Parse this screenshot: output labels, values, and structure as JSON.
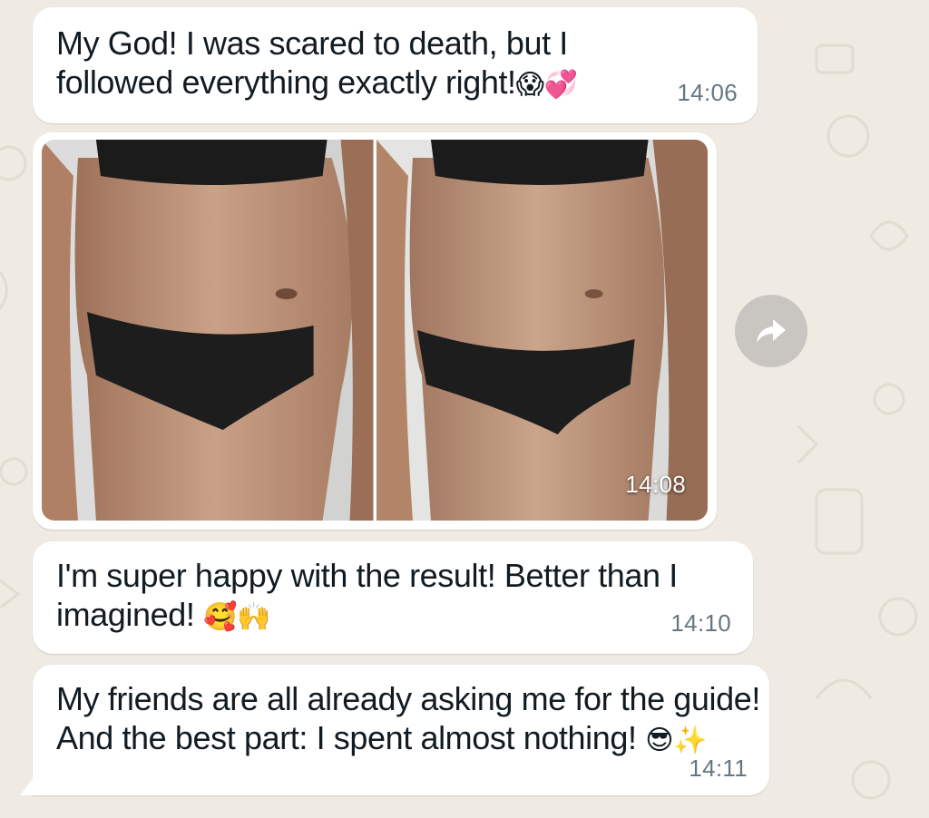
{
  "theme": {
    "chat_background": "#efeae2",
    "bubble": "#ffffff",
    "time_color": "#667781",
    "forward_button": "#c9c6c1"
  },
  "messages": [
    {
      "text_line1": "My God! I was scared to death, but I",
      "text_line2": "followed everything exactly right!",
      "emojis": "😱💞",
      "time": "14:06"
    },
    {
      "type": "image",
      "image_count": 2,
      "time": "14:08"
    },
    {
      "text_line1": "I'm super happy with the result! Better than I",
      "text_line2": "imagined!",
      "emojis": "🥰🙌",
      "time": "14:10"
    },
    {
      "text_line1": "My friends are all already asking me for the guide!",
      "text_line2": "And the best part: I spent almost nothing!",
      "emojis": "😎✨",
      "time": "14:11"
    }
  ],
  "icons": {
    "forward": "forward-arrow-icon",
    "photo_left": "before-photo",
    "photo_right": "after-photo"
  }
}
